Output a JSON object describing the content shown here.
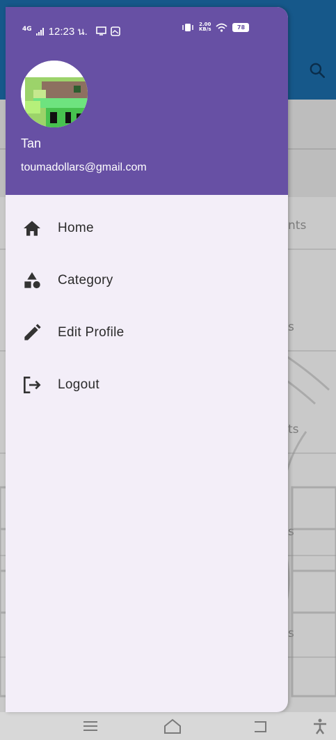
{
  "status_bar": {
    "network": "4G",
    "time": "12:23 น.",
    "speed_value": "2.00",
    "speed_unit": "KB/s",
    "battery": "78"
  },
  "drawer": {
    "user_name": "Tan",
    "user_email": "toumadollars@gmail.com",
    "menu": [
      {
        "label": "Home",
        "icon": "home-icon"
      },
      {
        "label": "Category",
        "icon": "category-icon"
      },
      {
        "label": "Edit Profile",
        "icon": "edit-icon"
      },
      {
        "label": "Logout",
        "icon": "logout-icon"
      }
    ]
  },
  "background_list": {
    "row_texts": [
      "nts",
      "s",
      "ts",
      "s",
      "s"
    ]
  },
  "colors": {
    "drawer_header": "#6750a4",
    "drawer_body": "#f3eef8",
    "app_bar": "#16588a"
  }
}
